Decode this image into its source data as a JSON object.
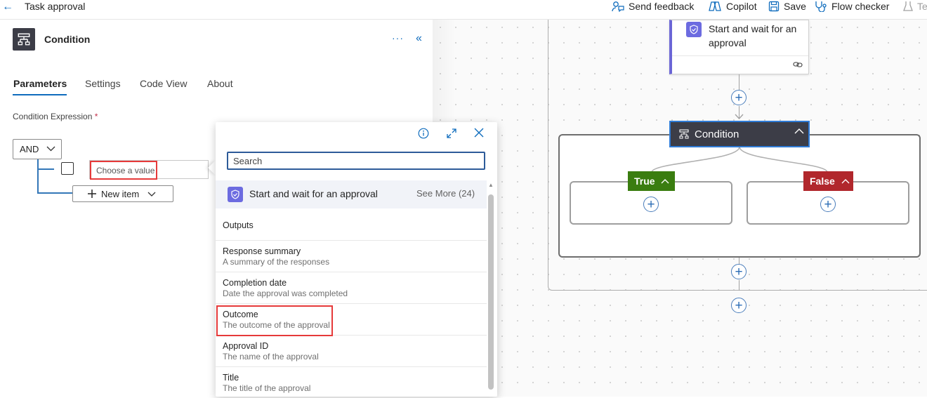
{
  "topbar": {
    "title": "Task approval",
    "items": [
      {
        "label": "Send feedback",
        "icon": "person-feedback-icon"
      },
      {
        "label": "Copilot",
        "icon": "copilot-icon"
      },
      {
        "label": "Save",
        "icon": "save-icon"
      },
      {
        "label": "Flow checker",
        "icon": "stethoscope-icon"
      },
      {
        "label": "Tes",
        "icon": "beaker-icon"
      }
    ]
  },
  "panel": {
    "title": "Condition",
    "more": "···",
    "collapse": "«",
    "tabs": [
      "Parameters",
      "Settings",
      "Code View",
      "About"
    ],
    "expression_label": "Condition Expression",
    "required_mark": "*",
    "operator": "AND",
    "value_placeholder": "Choose a value",
    "new_item": "New item"
  },
  "popup": {
    "search_placeholder": "Search",
    "action_name": "Start and wait for an approval",
    "see_more": "See More (24)",
    "outputs_heading": "Outputs",
    "outputs": [
      {
        "name": "Response summary",
        "desc": "A summary of the responses"
      },
      {
        "name": "Completion date",
        "desc": "Date the approval was completed"
      },
      {
        "name": "Outcome",
        "desc": "The outcome of the approval"
      },
      {
        "name": "Approval ID",
        "desc": "The name of the approval"
      },
      {
        "name": "Title",
        "desc": "The title of the approval"
      }
    ]
  },
  "canvas": {
    "approval_card_title": "Start and wait for an approval",
    "condition_label": "Condition",
    "true_label": "True",
    "false_label": "False",
    "add_symbol": "+"
  },
  "colors": {
    "accent": "#0f6cbd",
    "approval_purple": "#6c6be0",
    "true_green": "#3a7d10",
    "false_red": "#b1272c",
    "highlight_red": "#e63a3a",
    "condition_dark": "#3c3d47"
  }
}
